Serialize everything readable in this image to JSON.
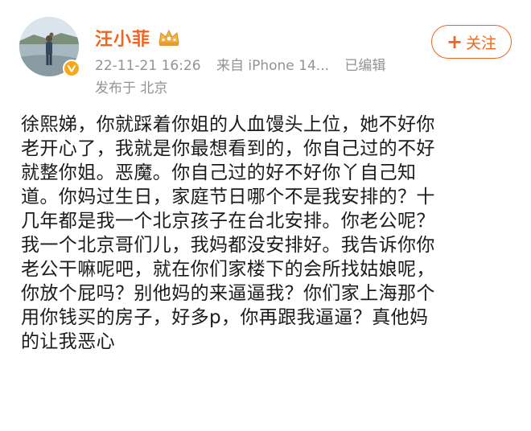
{
  "user": {
    "name": "汪小菲",
    "follow_plus": "+",
    "follow_label": "关注"
  },
  "meta": {
    "date": "22-11-21 16:26",
    "source": "来自 iPhone 14...",
    "edited": "已编辑",
    "location": "发布于 北京"
  },
  "icons": {
    "avatar": "avatar-photo",
    "verified": "verified-badge-icon",
    "vip": "vip-crown-icon"
  },
  "colors": {
    "name": "#f0641e",
    "accent": "#f0641e",
    "meta": "#939393",
    "badge": "#f7a91b"
  },
  "post": {
    "lines": [
      "徐熙娣，你就踩着你姐的人血馒头上位，她不好你",
      "老开心了，我就是你最想看到的，你自己过的不好",
      "就整你姐。恶魔。你自己过的好不好你丫自己知",
      "道。你妈过生日，家庭节日哪个不是我安排的？十",
      "几年都是我一个北京孩子在台北安排。你老公呢？",
      "我一个北京哥们儿，我妈都没安排好。我告诉你你",
      "老公干嘛呢吧，就在你们家楼下的会所找姑娘呢，",
      "你放个屁吗？别他妈的来逼逼我？你们家上海那个",
      "用你钱买的房子，好多p，你再跟我逼逼？真他妈",
      "的让我恶心"
    ]
  }
}
